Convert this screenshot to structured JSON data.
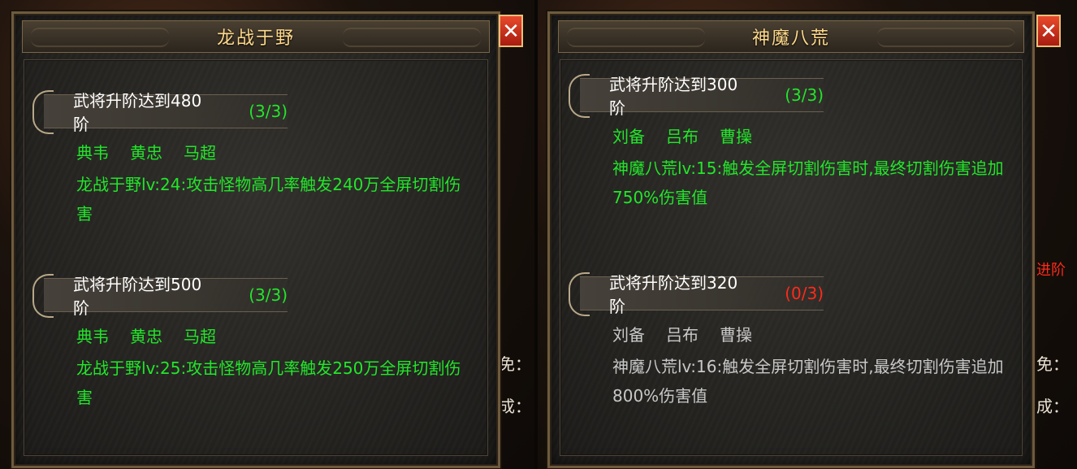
{
  "left_panel": {
    "title": "龙战于野",
    "close_label": "✕",
    "sections": [
      {
        "requirement": "武将升阶达到480阶",
        "progress": "(3/3)",
        "progress_color": "#22e62a",
        "heroes": [
          "典韦",
          "黄忠",
          "马超"
        ],
        "effect": "龙战于野lv:24:攻击怪物高几率触发240万全屏切割伤害",
        "active": true
      },
      {
        "requirement": "武将升阶达到500阶",
        "progress": "(3/3)",
        "progress_color": "#22e62a",
        "heroes": [
          "典韦",
          "黄忠",
          "马超"
        ],
        "effect": "龙战于野lv:25:攻击怪物高几率触发250万全屏切割伤害",
        "active": true
      }
    ],
    "edge_texts": [
      "免：",
      "成："
    ]
  },
  "right_panel": {
    "title": "神魔八荒",
    "close_label": "✕",
    "sections": [
      {
        "requirement": "武将升阶达到300阶",
        "progress": "(3/3)",
        "progress_color": "#22e62a",
        "heroes": [
          "刘备",
          "吕布",
          "曹操"
        ],
        "effect": "神魔八荒lv:15:触发全屏切割伤害时,最终切割伤害追加750%伤害值",
        "active": true
      },
      {
        "requirement": "武将升阶达到320阶",
        "progress": "(0/3)",
        "progress_color": "#ff2a1a",
        "heroes": [
          "刘备",
          "吕布",
          "曹操"
        ],
        "effect": "神魔八荒lv:16:触发全屏切割伤害时,最终切割伤害追加800%伤害值",
        "active": false
      }
    ],
    "edge_texts": [
      "进阶",
      "免：",
      "成："
    ]
  }
}
